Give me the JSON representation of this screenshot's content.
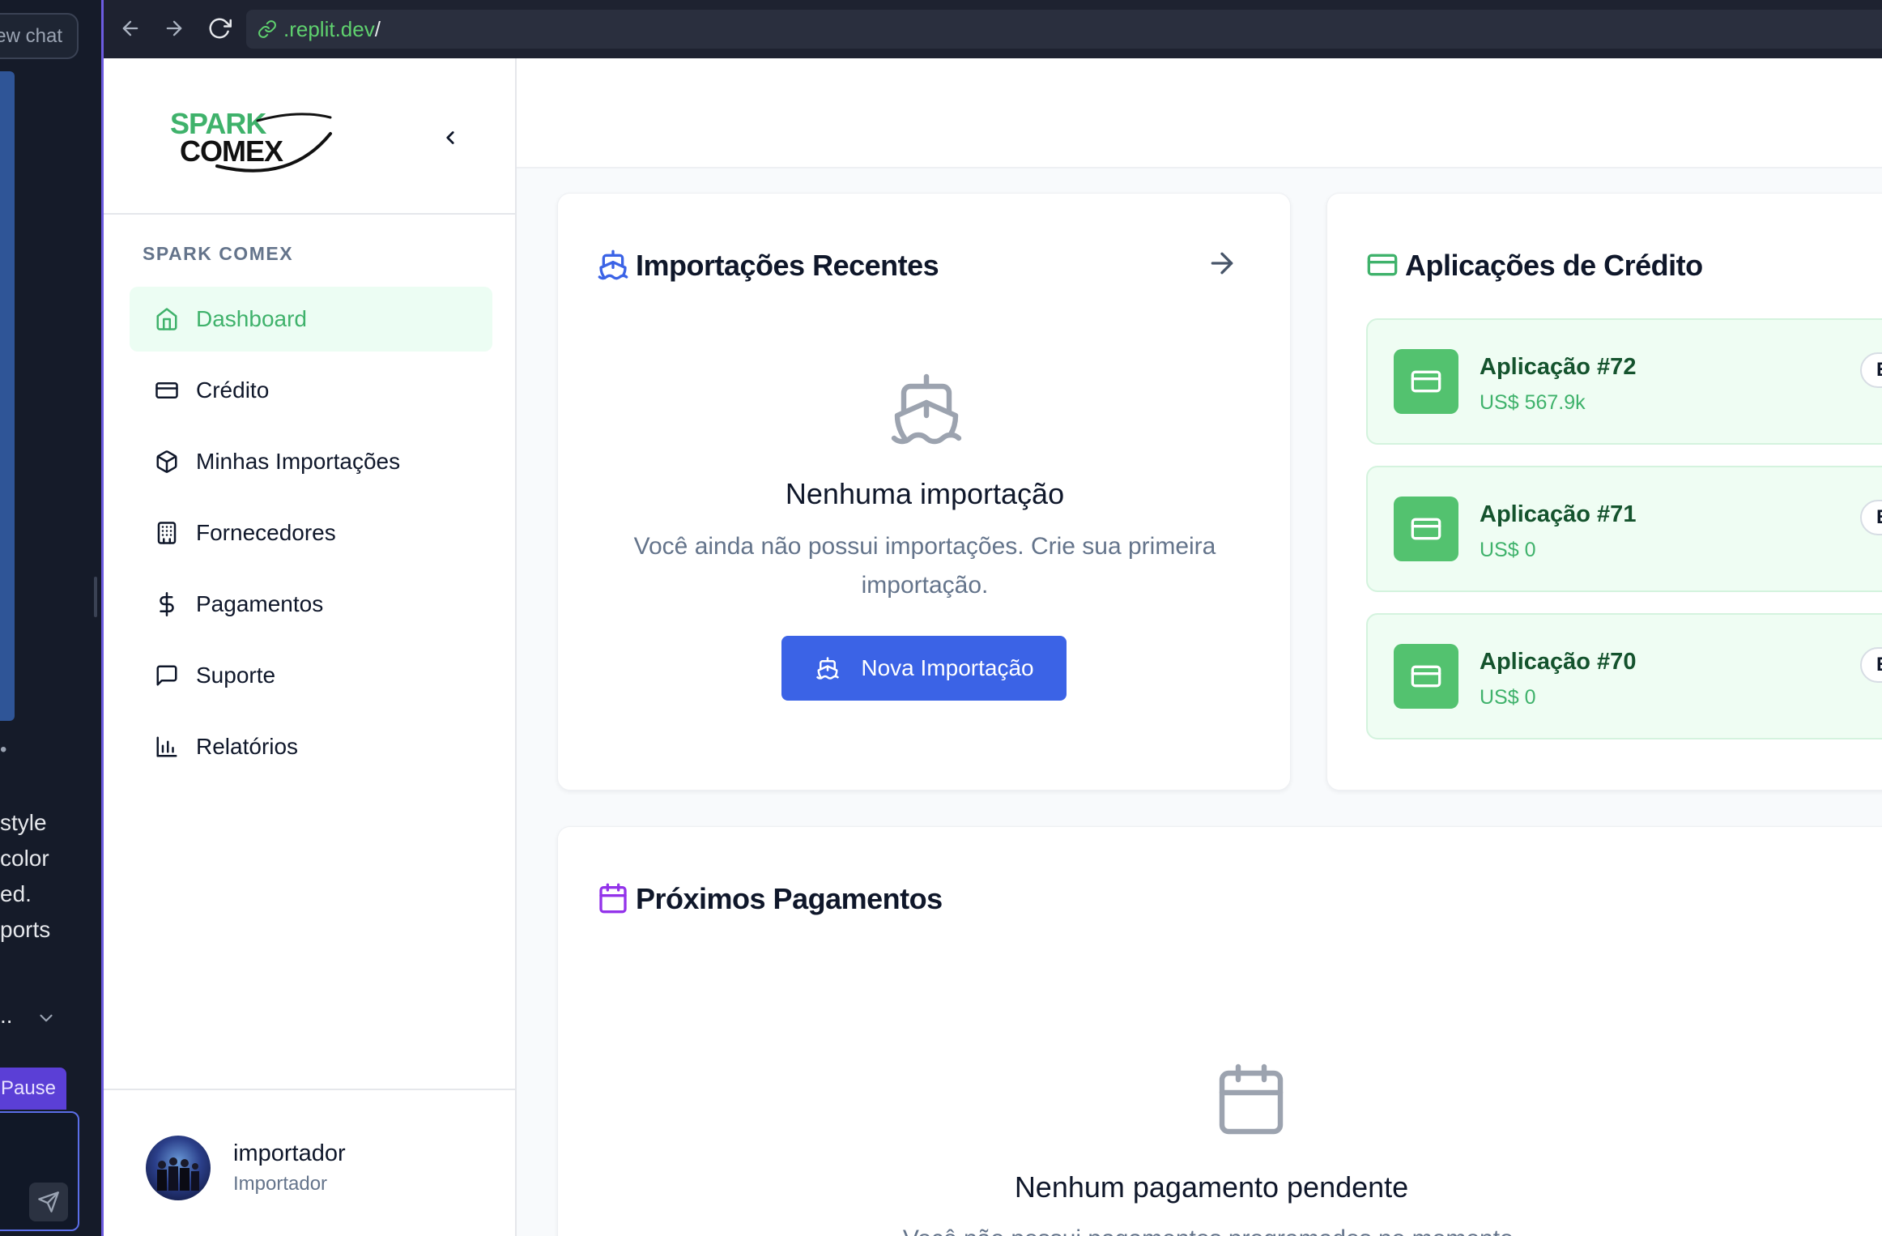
{
  "chat": {
    "new_chat_label": "ew chat",
    "lines": [
      "style",
      "color",
      "ed.",
      "ports"
    ],
    "dot": "•",
    "ellipsis": "..",
    "pause_label": "Pause"
  },
  "browser": {
    "url": ".replit.dev",
    "url_suffix": "/"
  },
  "sidebar": {
    "section_label": "SPARK COMEX",
    "items": [
      {
        "label": "Dashboard",
        "icon": "home-icon",
        "active": true
      },
      {
        "label": "Crédito",
        "icon": "credit-card-icon"
      },
      {
        "label": "Minhas Importações",
        "icon": "package-icon"
      },
      {
        "label": "Fornecedores",
        "icon": "building-icon"
      },
      {
        "label": "Pagamentos",
        "icon": "dollar-icon"
      },
      {
        "label": "Suporte",
        "icon": "message-icon"
      },
      {
        "label": "Relatórios",
        "icon": "bar-chart-icon"
      }
    ],
    "user": {
      "name": "importador",
      "role": "Importador"
    }
  },
  "logo": {
    "line1": "SPARK",
    "line2": "COMEX",
    "colors": {
      "spark": "#3fb26b",
      "comex": "#111111"
    }
  },
  "imports_card": {
    "title": "Importações Recentes",
    "empty_title": "Nenhuma importação",
    "empty_text": "Você ainda não possui importações. Crie sua primeira importação.",
    "button_label": "Nova Importação"
  },
  "credit_card": {
    "title": "Aplicações de Crédito",
    "items": [
      {
        "name": "Aplicação #72",
        "amount": "US$ 567.9k",
        "badge": "E"
      },
      {
        "name": "Aplicação #71",
        "amount": "US$ 0",
        "badge": "E"
      },
      {
        "name": "Aplicação #70",
        "amount": "US$ 0",
        "badge": "E"
      }
    ]
  },
  "payments_card": {
    "title": "Próximos Pagamentos",
    "empty_title": "Nenhum pagamento pendente",
    "empty_text": "Você não possui pagamentos programados no momento."
  },
  "colors": {
    "brand_green": "#3fb26b",
    "primary_blue": "#3b63e6",
    "purple_accent": "#9333ea",
    "accent_border": "#6d5ce0"
  }
}
